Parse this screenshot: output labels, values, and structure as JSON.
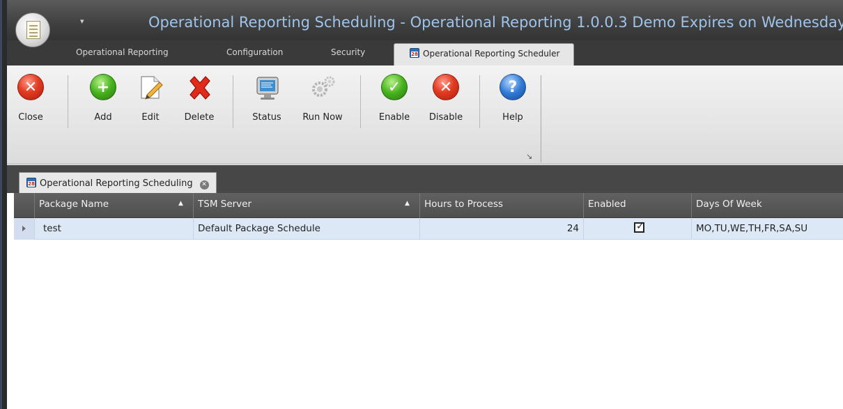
{
  "window": {
    "title": "Operational Reporting Scheduling - Operational Reporting 1.0.0.3 Demo Expires on Wednesday",
    "qat_glyph": "▾"
  },
  "ribbon_tabs": [
    {
      "label": "Operational Reporting"
    },
    {
      "label": "Configuration"
    },
    {
      "label": "Security"
    },
    {
      "label": "Operational Reporting Scheduler"
    }
  ],
  "ribbon": {
    "buttons": {
      "close": "Close",
      "add": "Add",
      "edit": "Edit",
      "delete": "Delete",
      "status": "Status",
      "run_now": "Run Now",
      "enable": "Enable",
      "disable": "Disable",
      "help": "Help"
    },
    "launcher_glyph": "↘"
  },
  "document_tab": {
    "label": "Operational Reporting Scheduling",
    "close_glyph": "✕"
  },
  "grid": {
    "columns": [
      {
        "label": "Package Name",
        "sorted": "asc"
      },
      {
        "label": "TSM Server",
        "sorted": "asc"
      },
      {
        "label": "Hours to Process"
      },
      {
        "label": "Enabled"
      },
      {
        "label": "Days Of Week"
      }
    ],
    "sort_glyph": "▲",
    "rows": [
      {
        "package_name": "test",
        "tsm_server": "Default Package Schedule",
        "hours_to_process": "24",
        "enabled": true,
        "days_of_week": "MO,TU,WE,TH,FR,SA,SU"
      }
    ]
  },
  "colors": {
    "title_text": "#9ec4ec",
    "selected_row": "#dde8f6",
    "header_bg": "#575757"
  }
}
